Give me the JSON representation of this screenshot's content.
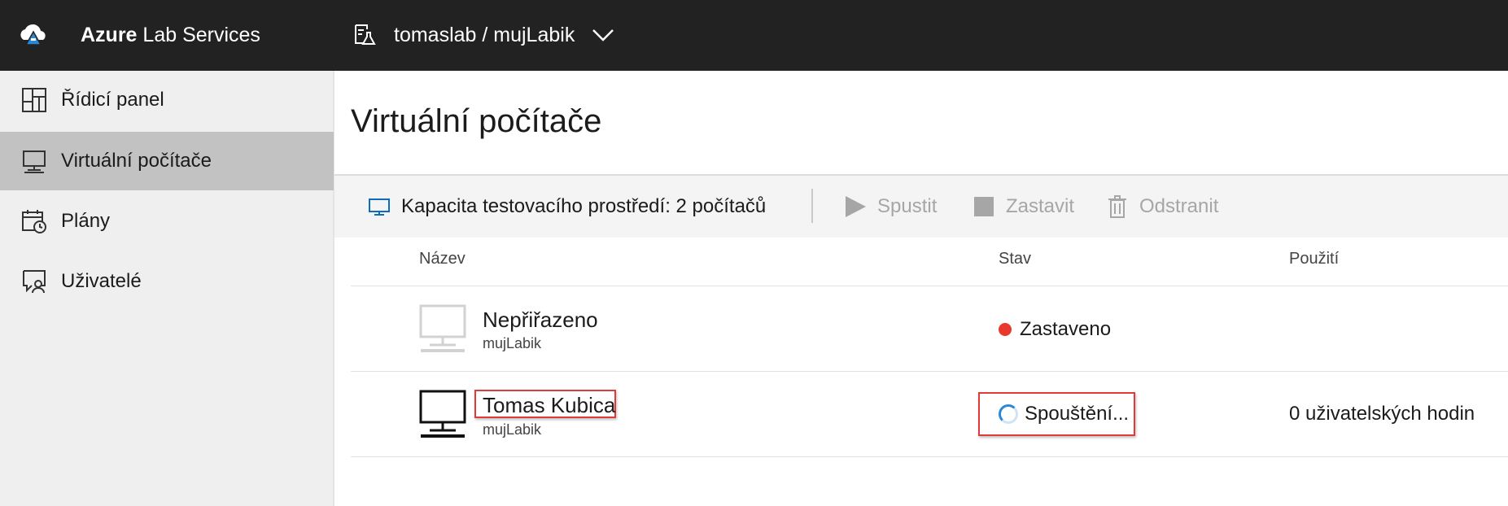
{
  "header": {
    "brand_bold": "Azure",
    "brand_rest": " Lab Services",
    "breadcrumb": "tomaslab / mujLabik",
    "icons": {
      "brand": "azure-cloud-logo",
      "lab": "lab-flask-icon",
      "dropdown": "chevron-down-icon"
    }
  },
  "sidebar": {
    "items": [
      {
        "label": "Řídicí panel",
        "icon": "dashboard-icon",
        "active": false
      },
      {
        "label": "Virtuální počítače",
        "icon": "monitor-icon",
        "active": true
      },
      {
        "label": "Plány",
        "icon": "calendar-clock-icon",
        "active": false
      },
      {
        "label": "Uživatelé",
        "icon": "users-icon",
        "active": false
      }
    ]
  },
  "main": {
    "title": "Virtuální počítače",
    "toolbar": {
      "capacity": "Kapacita testovacího prostředí: 2 počítačů",
      "start": "Spustit",
      "stop": "Zastavit",
      "delete": "Odstranit"
    },
    "columns": {
      "name": "Název",
      "status": "Stav",
      "usage": "Použití"
    },
    "rows": [
      {
        "name": "Nepřiřazeno",
        "lab": "mujLabik",
        "status": "Zastaveno",
        "usage": "",
        "status_color": "#e8392c"
      },
      {
        "name": "Tomas Kubica",
        "lab": "mujLabik",
        "status": "Spouštění...",
        "usage": "0 uživatelských hodin"
      }
    ]
  },
  "colors": {
    "topbar": "#222222",
    "sidebar": "#efefef",
    "active_nav": "#c2c2c2",
    "accent": "#2b88d8",
    "stopped": "#e8392c",
    "highlight": "#e03a3a"
  }
}
